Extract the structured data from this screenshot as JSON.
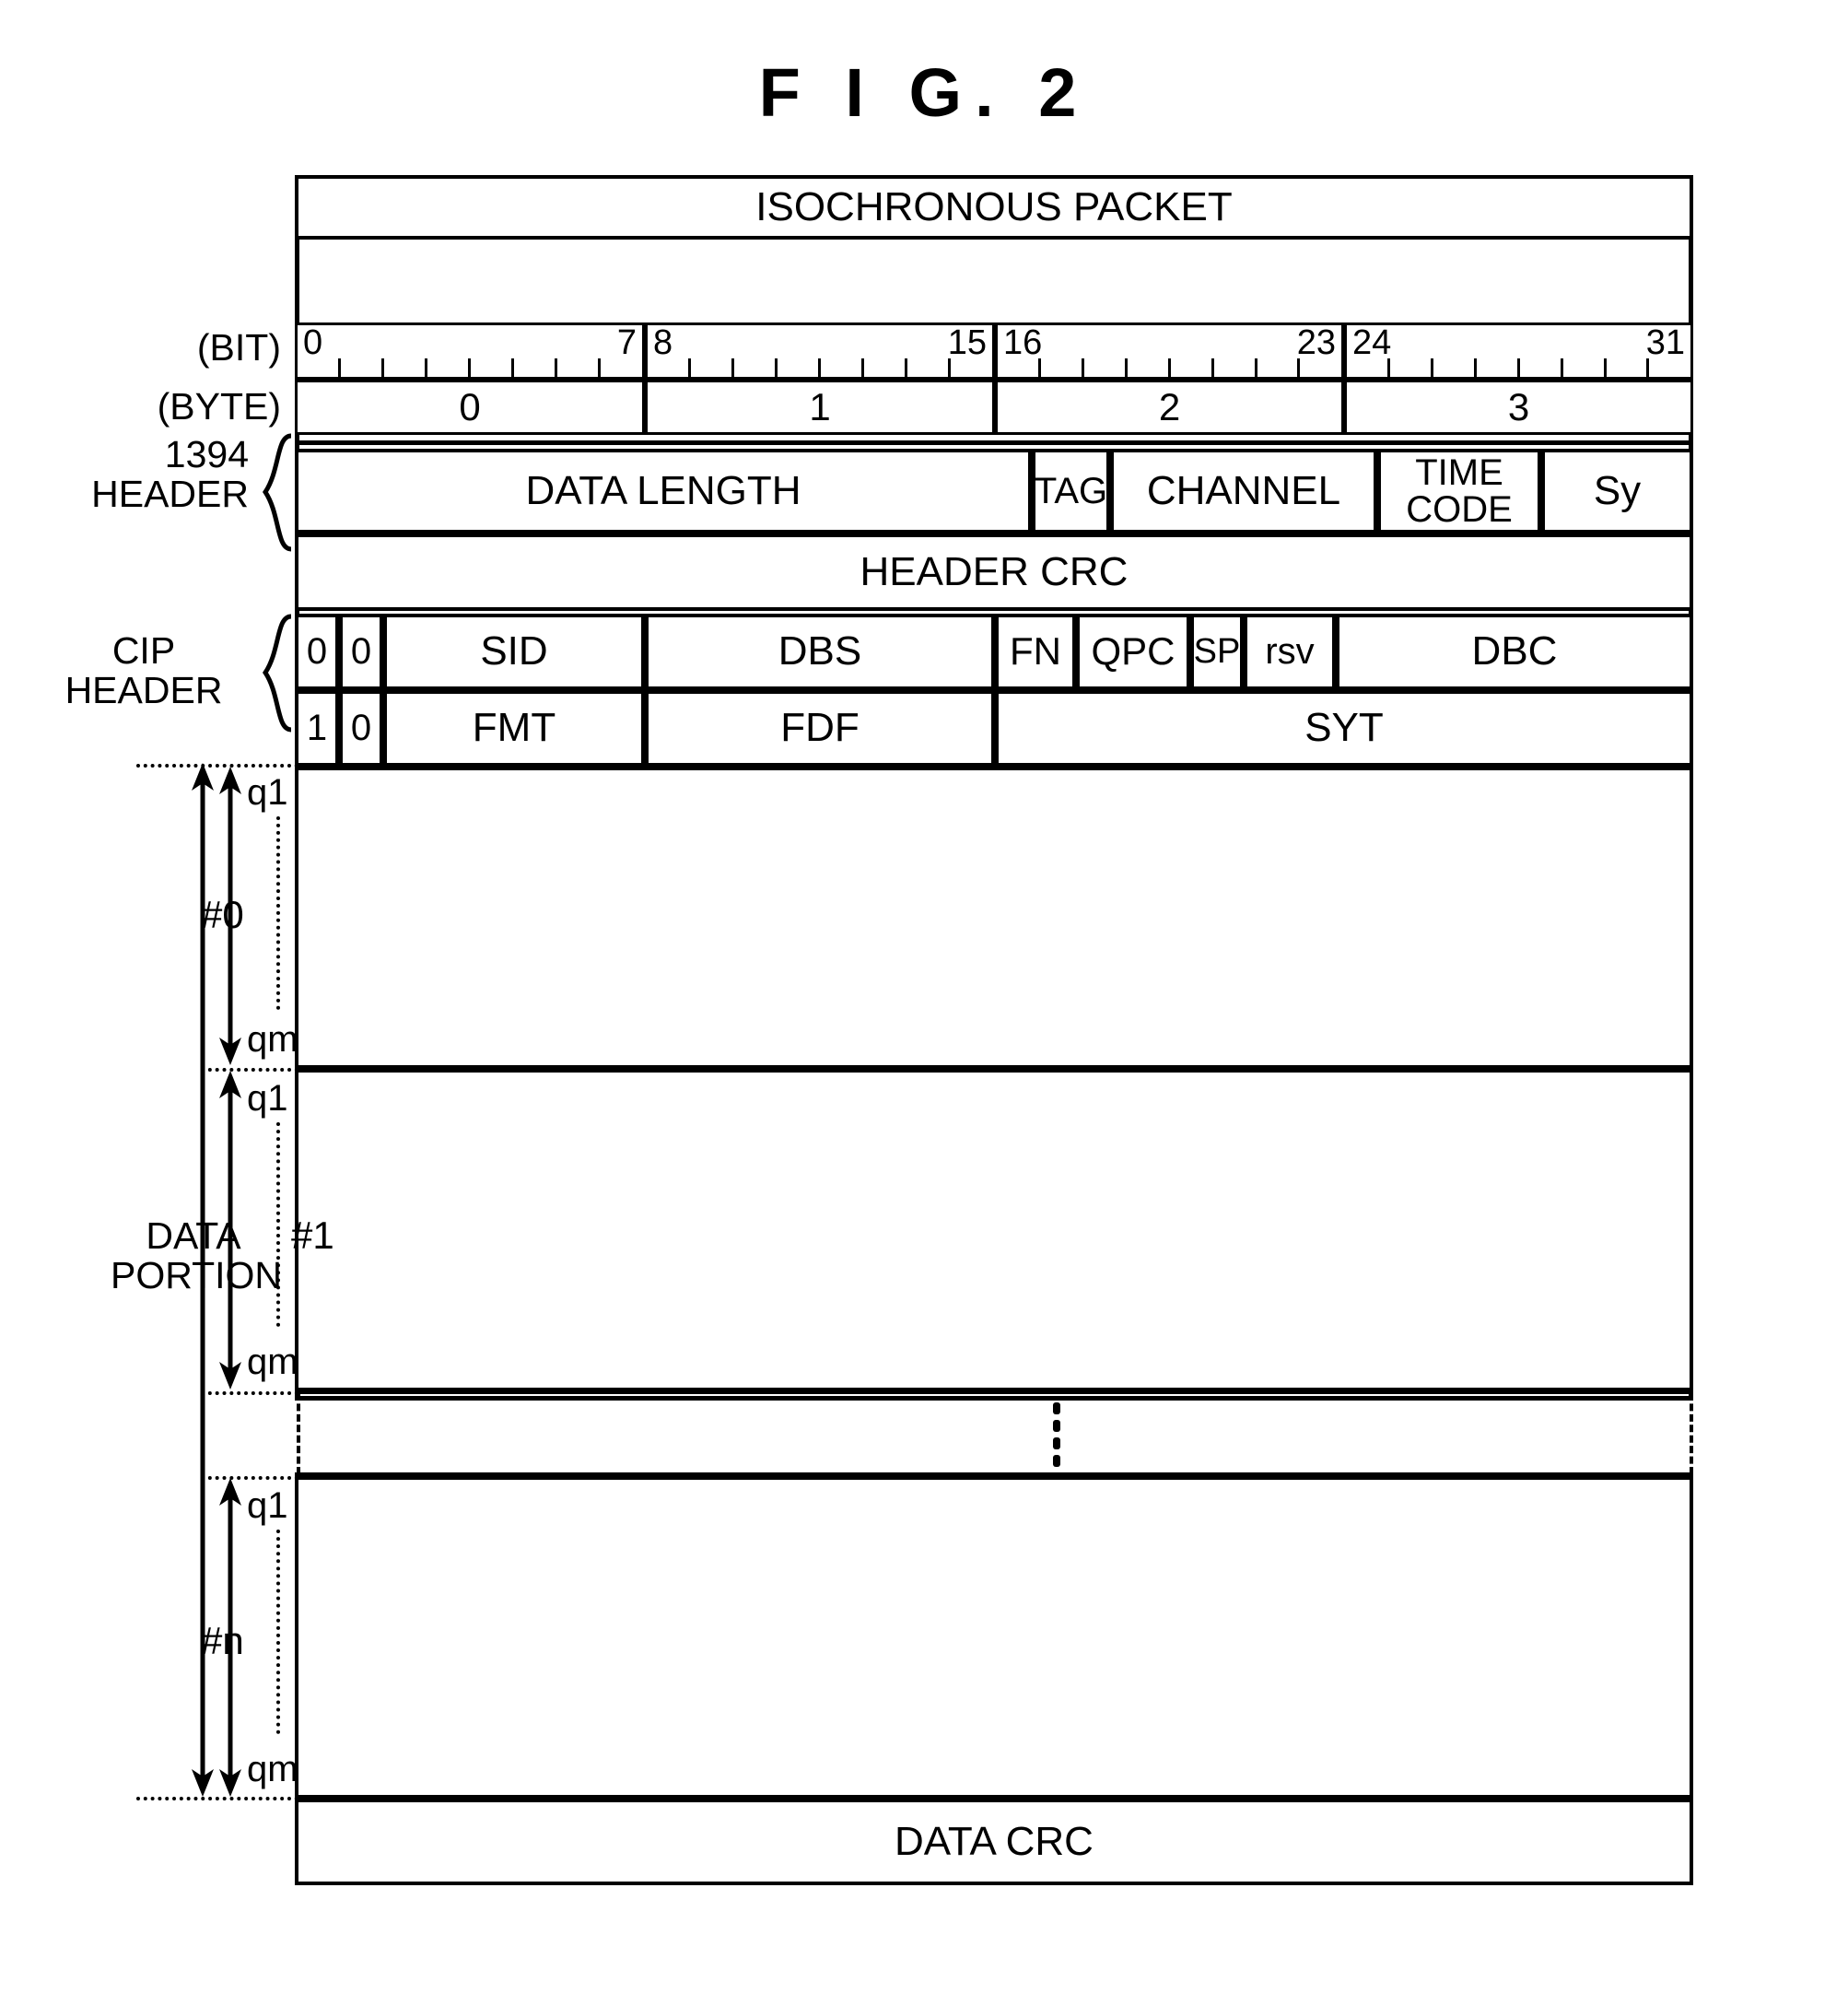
{
  "figure": {
    "title": "F I G. 2",
    "packet_title": "ISOCHRONOUS PACKET"
  },
  "axis": {
    "bit_label": "(BIT)",
    "byte_label": "(BYTE)",
    "bit_ranges": [
      {
        "start": "0",
        "end": "7"
      },
      {
        "start": "8",
        "end": "15"
      },
      {
        "start": "16",
        "end": "23"
      },
      {
        "start": "24",
        "end": "31"
      }
    ],
    "byte_numbers": [
      "0",
      "1",
      "2",
      "3"
    ]
  },
  "sections": {
    "header_1394_label": "1394\nHEADER",
    "cip_header_label": "CIP\nHEADER",
    "data_portion_label": "DATA\nPORTION"
  },
  "header_1394": {
    "row1": [
      {
        "name": "data-length",
        "label": "DATA LENGTH"
      },
      {
        "name": "tag",
        "label": "TAG"
      },
      {
        "name": "channel",
        "label": "CHANNEL"
      },
      {
        "name": "time-code",
        "label": "TIME\nCODE"
      },
      {
        "name": "sy",
        "label": "Sy"
      }
    ],
    "row2": [
      {
        "name": "header-crc",
        "label": "HEADER CRC"
      }
    ]
  },
  "cip_header": {
    "row1": [
      {
        "name": "bit0",
        "label": "0"
      },
      {
        "name": "bit1",
        "label": "0"
      },
      {
        "name": "sid",
        "label": "SID"
      },
      {
        "name": "dbs",
        "label": "DBS"
      },
      {
        "name": "fn",
        "label": "FN"
      },
      {
        "name": "qpc",
        "label": "QPC"
      },
      {
        "name": "sp",
        "label": "SP"
      },
      {
        "name": "rsv",
        "label": "rsv"
      },
      {
        "name": "dbc",
        "label": "DBC"
      }
    ],
    "row2": [
      {
        "name": "bit0",
        "label": "1"
      },
      {
        "name": "bit1",
        "label": "0"
      },
      {
        "name": "fmt",
        "label": "FMT"
      },
      {
        "name": "fdf",
        "label": "FDF"
      },
      {
        "name": "syt",
        "label": "SYT"
      }
    ]
  },
  "data_portion": {
    "blocks": [
      {
        "name": "block-0",
        "index_label": "#0",
        "top_label": "q1",
        "bottom_label": "qm"
      },
      {
        "name": "block-1",
        "index_label": "#1",
        "top_label": "q1",
        "bottom_label": "qm"
      },
      {
        "name": "block-n",
        "index_label": "#n",
        "top_label": "q1",
        "bottom_label": "qm"
      }
    ],
    "ellipsis": "⋮"
  },
  "footer": {
    "data_crc": "DATA CRC"
  },
  "colors": {
    "ink": "#000000",
    "paper": "#ffffff"
  }
}
